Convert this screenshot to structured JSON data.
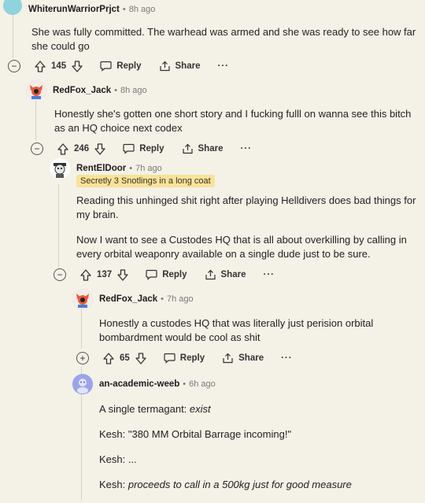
{
  "comments": [
    {
      "username": "WhiterunWarriorPrjct",
      "time": "8h ago",
      "body": [
        "She was fully committed. The warhead was armed and she was ready to see how far she could go"
      ],
      "votes": "145",
      "reply_label": "Reply",
      "share_label": "Share",
      "more_label": "···",
      "toggle": "−",
      "avatar_color": "#8fd3dc"
    },
    {
      "username": "RedFox_Jack",
      "time": "8h ago",
      "body": [
        "Honestly she's gotten one short story and I fucking fulll on wanna see this bitch as an HQ choice next codex"
      ],
      "votes": "246",
      "reply_label": "Reply",
      "share_label": "Share",
      "more_label": "···",
      "toggle": "−",
      "avatar_color": "#e85a3a"
    },
    {
      "username": "RentElDoor",
      "time": "7h ago",
      "flair": "Secretly 3 Snotlings in a long coat",
      "body": [
        "Reading this unhinged shit right after playing Helldivers does bad things for my brain.",
        "Now I want to see a Custodes HQ that is all about overkilling by calling in every orbital weaponry available on a single dude just to be sure."
      ],
      "votes": "137",
      "reply_label": "Reply",
      "share_label": "Share",
      "more_label": "···",
      "toggle": "−",
      "avatar_color": "#ffffff"
    },
    {
      "username": "RedFox_Jack",
      "time": "7h ago",
      "body": [
        "Honestly a custodes HQ that was literally just perision orbital bombardment would be cool as shit"
      ],
      "votes": "65",
      "reply_label": "Reply",
      "share_label": "Share",
      "more_label": "···",
      "toggle": "+",
      "avatar_color": "#e85a3a"
    },
    {
      "username": "an-academic-weeb",
      "time": "6h ago",
      "body_parts": {
        "l1_plain": "A single termagant: ",
        "l1_em": "exist",
        "l2": "Kesh: \"380 MM Orbital Barrage incoming!\"",
        "l3": "Kesh: ...",
        "l4_plain": "Kesh: ",
        "l4_em": "proceeds to call in a 500kg just for good measure"
      },
      "avatar_color": "#9aa5e8"
    }
  ]
}
